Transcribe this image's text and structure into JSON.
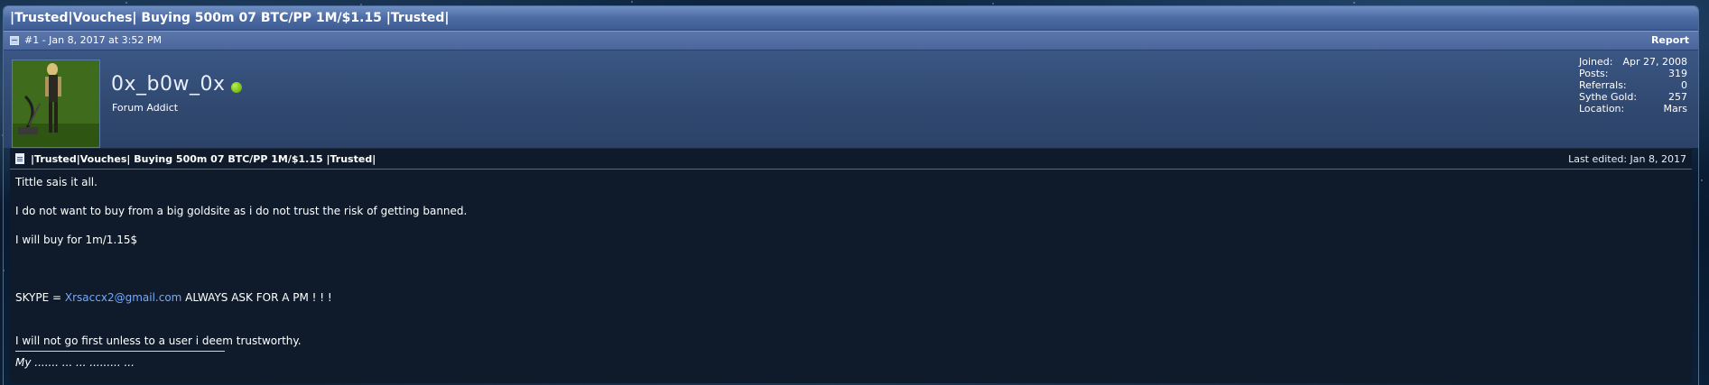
{
  "thread": {
    "title": "|Trusted|Vouches| Buying 500m 07 BTC/PP 1M/$1.15 |Trusted|"
  },
  "post_meta": {
    "number_date": "#1 - Jan 8, 2017 at 3:52 PM",
    "report_label": "Report"
  },
  "user": {
    "username": "0x_b0w_0x",
    "title": "Forum Addict",
    "status": "online",
    "stats": [
      {
        "label": "Joined:",
        "value": "Apr 27, 2008"
      },
      {
        "label": "Posts:",
        "value": "319"
      },
      {
        "label": "Referrals:",
        "value": "0"
      },
      {
        "label": "Sythe Gold:",
        "value": "257"
      },
      {
        "label": "Location:",
        "value": "Mars"
      }
    ]
  },
  "post": {
    "title": "|Trusted|Vouches| Buying 500m 07 BTC/PP 1M/$1.15 |Trusted|",
    "last_edited": "Last edited: Jan 8, 2017",
    "lines": {
      "l1": "Tittle sais it all.",
      "l2": "I do not want to buy from a big goldsite as i do not trust the risk of getting banned.",
      "l3": "I will buy for 1m/1.15$",
      "skype_prefix": "SKYPE = ",
      "skype_email": "Xrsaccx2@gmail.com",
      "skype_suffix": " ALWAYS ASK FOR A PM ! ! !",
      "l5": "I will not go first unless to a user i deem trustworthy."
    },
    "signature_partial": "My ....... ... ... ......... ..."
  },
  "colors": {
    "header_blue": "#4c6ba3",
    "body_bg": "#0f1b2b",
    "link_blue": "#73aaff",
    "online_green": "#7dc21a"
  }
}
